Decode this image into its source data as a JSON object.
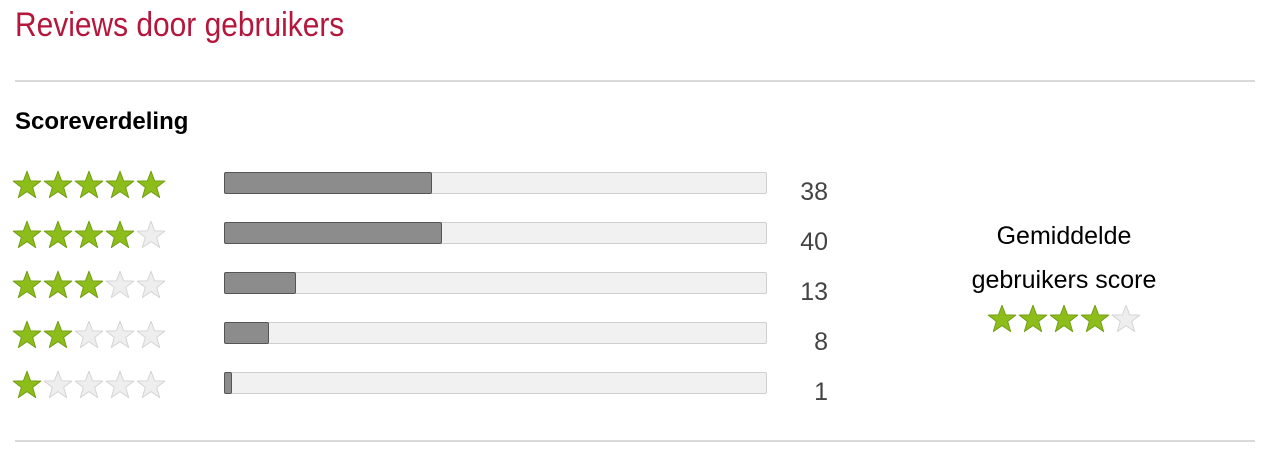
{
  "header": {
    "title": "Reviews door gebruikers"
  },
  "distribution": {
    "title": "Scoreverdeling",
    "max_count": 40,
    "rows": [
      {
        "stars": 5,
        "count": "38",
        "fraction": 0.38
      },
      {
        "stars": 4,
        "count": "40",
        "fraction": 0.4
      },
      {
        "stars": 3,
        "count": "13",
        "fraction": 0.13
      },
      {
        "stars": 2,
        "count": "8",
        "fraction": 0.08
      },
      {
        "stars": 1,
        "count": "1",
        "fraction": 0.01
      }
    ]
  },
  "average": {
    "label_line1": "Gemiddelde",
    "label_line2": "gebruikers score",
    "stars": 4
  },
  "colors": {
    "title": "#b5163c",
    "star_filled": "#8cbd1a",
    "star_empty": "#eeeeee",
    "bar_fill": "#8c8c8c",
    "bar_track": "#f1f1f1"
  },
  "icons": {
    "filled": "star-filled-icon",
    "empty": "star-empty-icon"
  }
}
